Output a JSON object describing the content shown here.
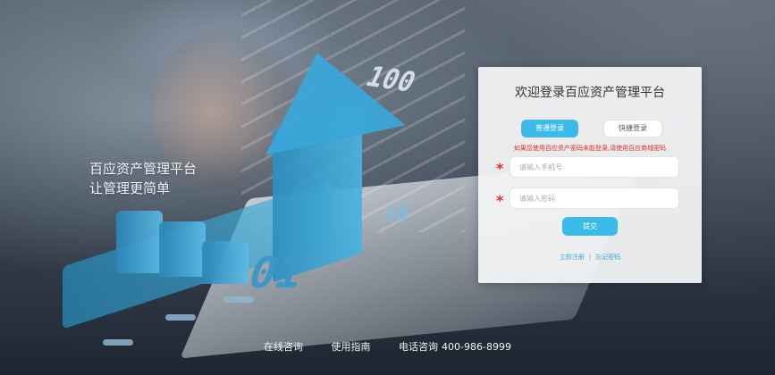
{
  "hero": {
    "numbers": {
      "n100": "100",
      "n10": "10",
      "n01": "01"
    },
    "tagline_line1": "百应资产管理平台",
    "tagline_line2": "让管理更简单"
  },
  "login": {
    "title": "欢迎登录百应资产管理平台",
    "tabs": [
      {
        "label": "普通登录",
        "active": true
      },
      {
        "label": "快捷登录",
        "active": false
      }
    ],
    "notice": "如果您使用百应资产密码未能登录,请使用百应商城密码",
    "required_mark": "*",
    "phone_placeholder": "请输入手机号",
    "password_placeholder": "请输入密码",
    "submit_label": "提交",
    "register_link": "立即注册",
    "link_separator": "|",
    "forgot_link": "忘记密码",
    "accent_color": "#3dbbe8",
    "notice_color": "#e0302b"
  },
  "footer": {
    "online_consult": "在线咨询",
    "guide": "使用指南",
    "phone_label": "电话咨询",
    "phone_number": "400-986-8999"
  }
}
